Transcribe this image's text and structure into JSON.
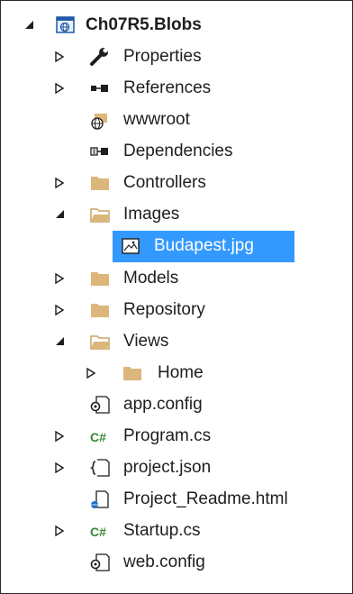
{
  "tree": {
    "root": {
      "label": "Ch07R5.Blobs",
      "icon": "web-project-icon",
      "expanded": true
    },
    "items": [
      {
        "label": "Properties",
        "icon": "wrench-icon",
        "expander": "collapsed"
      },
      {
        "label": "References",
        "icon": "references-icon",
        "expander": "collapsed"
      },
      {
        "label": "wwwroot",
        "icon": "globe-folder-icon",
        "expander": "none"
      },
      {
        "label": "Dependencies",
        "icon": "dependencies-icon",
        "expander": "none"
      },
      {
        "label": "Controllers",
        "icon": "folder-icon",
        "expander": "collapsed"
      },
      {
        "label": "Images",
        "icon": "folder-open-icon",
        "expander": "expanded"
      },
      {
        "label": "Budapest.jpg",
        "icon": "image-file-icon",
        "expander": "none",
        "selected": true
      },
      {
        "label": "Models",
        "icon": "folder-icon",
        "expander": "collapsed"
      },
      {
        "label": "Repository",
        "icon": "folder-icon",
        "expander": "collapsed"
      },
      {
        "label": "Views",
        "icon": "folder-open-icon",
        "expander": "expanded"
      },
      {
        "label": "Home",
        "icon": "folder-icon",
        "expander": "collapsed"
      },
      {
        "label": "app.config",
        "icon": "config-file-icon",
        "expander": "none"
      },
      {
        "label": "Program.cs",
        "icon": "csharp-file-icon",
        "expander": "collapsed"
      },
      {
        "label": "project.json",
        "icon": "json-file-icon",
        "expander": "collapsed"
      },
      {
        "label": "Project_Readme.html",
        "icon": "html-file-icon",
        "expander": "none"
      },
      {
        "label": "Startup.cs",
        "icon": "csharp-file-icon",
        "expander": "collapsed"
      },
      {
        "label": "web.config",
        "icon": "config-file-icon",
        "expander": "none"
      }
    ]
  },
  "colors": {
    "selection": "#3399ff",
    "folder": "#dcb67a",
    "csharp": "#388a34",
    "text": "#1e1e1e"
  }
}
